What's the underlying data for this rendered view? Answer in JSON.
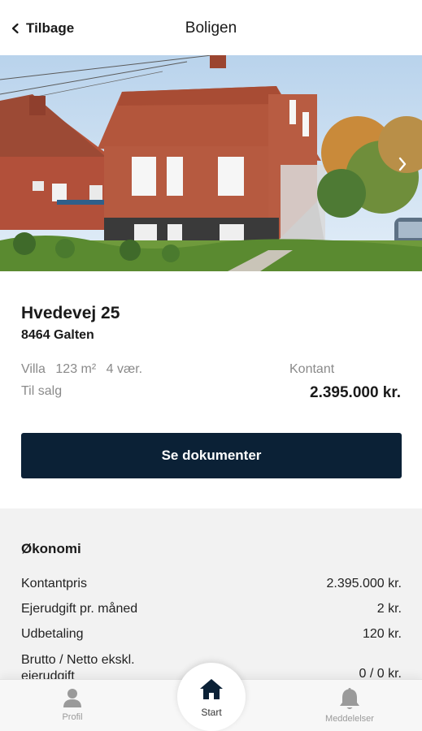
{
  "header": {
    "back_label": "Tilbage",
    "title": "Boligen"
  },
  "hero": {
    "photo_subject": "house-photo",
    "next_icon": "chevron-right-icon"
  },
  "property": {
    "address": "Hvedevej 25",
    "city": "8464 Galten",
    "type": "Villa",
    "area": "123 m²",
    "rooms": "4 vær.",
    "status": "Til salg",
    "price_label": "Kontant",
    "price": "2.395.000 kr."
  },
  "actions": {
    "documents_label": "Se dokumenter"
  },
  "economy": {
    "heading": "Økonomi",
    "rows": [
      {
        "label": "Kontantpris",
        "value": "2.395.000 kr."
      },
      {
        "label": "Ejerudgift pr. måned",
        "value": "2 kr."
      },
      {
        "label": "Udbetaling",
        "value": "120 kr."
      },
      {
        "label": "Brutto / Netto ekskl. ejerudgift",
        "value": "0 / 0 kr."
      }
    ]
  },
  "tabs": {
    "profile": "Profil",
    "start": "Start",
    "messages": "Meddelelser"
  },
  "colors": {
    "primary": "#0b2136",
    "muted_text": "#8a8a8a",
    "section_bg": "#f2f2f2"
  }
}
